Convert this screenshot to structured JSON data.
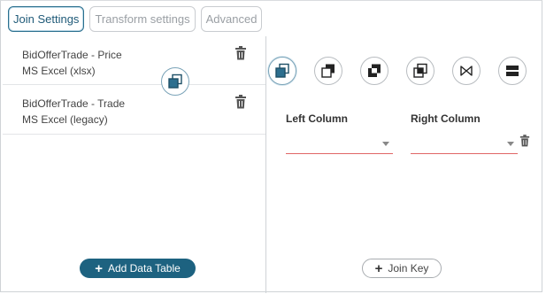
{
  "tabs": [
    {
      "label": "Join Settings",
      "active": true
    },
    {
      "label": "Transform settings",
      "active": false
    },
    {
      "label": "Advanced",
      "active": false
    }
  ],
  "data_tables": [
    {
      "name": "BidOfferTrade - Price",
      "source": "MS Excel (xlsx)"
    },
    {
      "name": "BidOfferTrade - Trade",
      "source": "MS Excel (legacy)"
    }
  ],
  "add_table_button": {
    "label": "Add Data Table"
  },
  "join_types": [
    "left-join-icon",
    "right-join-icon",
    "inner-join-icon",
    "outer-join-icon",
    "natural-join-icon",
    "union-icon"
  ],
  "columns": {
    "left_label": "Left Column",
    "right_label": "Right Column",
    "left_value": "",
    "right_value": ""
  },
  "join_key_button": {
    "label": "Join Key"
  },
  "colors": {
    "accent": "#1d6280",
    "error_underline": "#e06666"
  }
}
